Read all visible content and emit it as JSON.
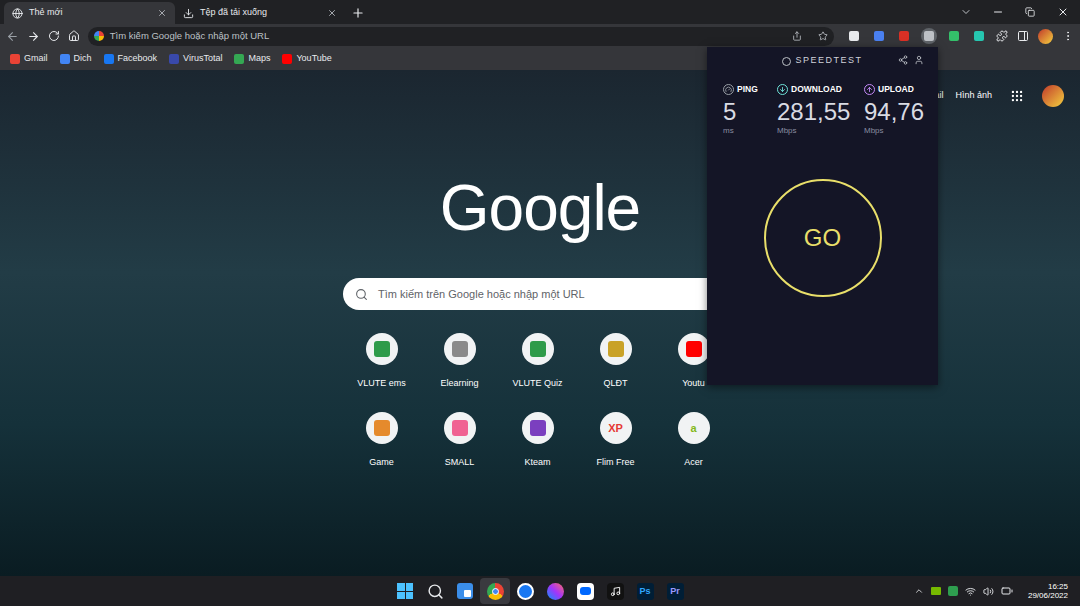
{
  "browser": {
    "tabs": [
      {
        "label": "Thẻ mới",
        "selected": true,
        "kind": "page"
      },
      {
        "label": "Tệp đã tải xuống",
        "selected": false,
        "kind": "download"
      }
    ],
    "address_bar": {
      "placeholder": "Tìm kiếm Google hoặc nhập một URL"
    },
    "extensions": [
      {
        "color": "#e8eaed",
        "selected": false
      },
      {
        "color": "#4a80f0",
        "selected": false
      },
      {
        "color": "#d93025",
        "selected": false
      },
      {
        "color": "#bdc1c6",
        "selected": true
      },
      {
        "color": "#34c06a",
        "selected": false
      },
      {
        "color": "#26c6b0",
        "selected": false
      }
    ],
    "bookmarks": [
      {
        "label": "Gmail",
        "color": "#ea4335"
      },
      {
        "label": "Dich",
        "color": "#4285f4"
      },
      {
        "label": "Facebook",
        "color": "#1877f2"
      },
      {
        "label": "VirusTotal",
        "color": "#3949ab"
      },
      {
        "label": "Maps",
        "color": "#34a853"
      },
      {
        "label": "YouTube",
        "color": "#ff0000"
      }
    ]
  },
  "new_tab_page": {
    "top_links": [
      "ail",
      "Hình ảnh"
    ],
    "logo": "Google",
    "search": {
      "placeholder": "Tìm kiếm trên Google hoặc nhập một URL"
    },
    "shortcuts": [
      {
        "label": "VLUTE ems",
        "color": "#2e9b4a"
      },
      {
        "label": "Elearning",
        "color": "#8a8a8a"
      },
      {
        "label": "VLUTE Quiz",
        "color": "#2e9b4a"
      },
      {
        "label": "QLĐT",
        "color": "#c9a227"
      },
      {
        "label": "Youtu",
        "color": "#ff0000"
      },
      {
        "label": "Game",
        "color": "#e58a2c"
      },
      {
        "label": "SMALL",
        "color": "#f06292"
      },
      {
        "label": "Kteam",
        "color": "#7b3fbf"
      },
      {
        "label": "Flim Free",
        "color": "#e53935",
        "glyph": "XP"
      },
      {
        "label": "Acer",
        "color": "#83b81a",
        "glyph": "a"
      }
    ]
  },
  "speedtest": {
    "title": "SPEEDTEST",
    "metrics": [
      {
        "label": "PING",
        "value": "5",
        "unit": "ms",
        "color": "#9aa0a6",
        "kind": "ping"
      },
      {
        "label": "DOWNLOAD",
        "value": "281,55",
        "unit": "Mbps",
        "color": "#6fe3d9",
        "kind": "download"
      },
      {
        "label": "UPLOAD",
        "value": "94,76",
        "unit": "Mbps",
        "color": "#c58af9",
        "kind": "upload"
      }
    ],
    "button": "GO"
  },
  "taskbar": {
    "apps": [
      {
        "kind": "start",
        "color": "#4cc2ff",
        "selected": false
      },
      {
        "kind": "search",
        "color": "#e8eaed",
        "selected": false
      },
      {
        "kind": "widgets",
        "color": "#3b8eea",
        "selected": false
      },
      {
        "kind": "chrome",
        "color": "#34a853",
        "selected": true
      },
      {
        "kind": "facebook",
        "color": "#1877f2",
        "selected": false
      },
      {
        "kind": "messenger",
        "color": "#a64dff",
        "selected": false
      },
      {
        "kind": "zalo",
        "color": "#0068ff",
        "selected": false
      },
      {
        "kind": "tiktok",
        "color": "#111111",
        "selected": false
      },
      {
        "kind": "badge",
        "glyph": "Ps",
        "color": "#31a8ff",
        "selected": false
      },
      {
        "kind": "badge",
        "glyph": "Pr",
        "color": "#9999ff",
        "selected": false
      }
    ],
    "time": "16:25",
    "date": "29/06/2022"
  }
}
